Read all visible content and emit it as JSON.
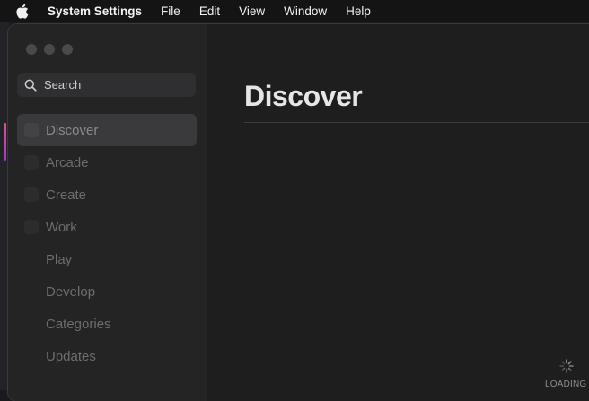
{
  "menubar": {
    "app_name": "System Settings",
    "items": [
      "File",
      "Edit",
      "View",
      "Window",
      "Help"
    ]
  },
  "search": {
    "placeholder": "Search"
  },
  "sidebar": {
    "items": [
      {
        "label": "Discover",
        "selected": true
      },
      {
        "label": "Arcade"
      },
      {
        "label": "Create"
      },
      {
        "label": "Work"
      },
      {
        "label": "Play"
      },
      {
        "label": "Develop"
      },
      {
        "label": "Categories"
      },
      {
        "label": "Updates"
      }
    ]
  },
  "main": {
    "title": "Discover"
  },
  "status": {
    "loading_text": "LOADING"
  },
  "colors": {
    "background": "#1e1e1e",
    "sidebar": "#242424",
    "selected": "#3a3a3c"
  }
}
